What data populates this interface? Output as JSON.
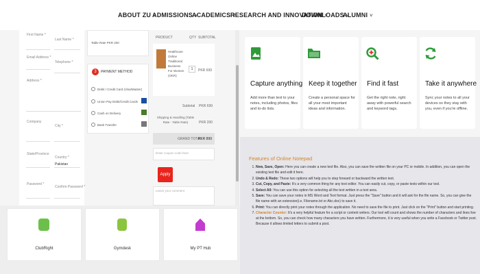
{
  "nav": {
    "items": [
      {
        "label": "ABOUT ZU"
      },
      {
        "label": "ADMISSIONS"
      },
      {
        "label": "ACADEMICS"
      },
      {
        "label": "RESEARCH AND INNOVATION"
      },
      {
        "label": "DOWNLOADS"
      },
      {
        "label": "ALUMNI"
      }
    ]
  },
  "checkout": {
    "first_name": "First Name *",
    "last_name": "Last Name *",
    "email": "Email Address *",
    "telephone": "Telephone *",
    "address": "Address *",
    "company": "Company",
    "city": "City *",
    "state": "State/Province",
    "country": "Country *",
    "country_value": "Pakistan",
    "password": "Password *",
    "confirm_password": "Confirm Password *",
    "table_rate": "Table Rate PKR 200",
    "payment_step": "3",
    "payment_title": "PAYMENT METHOD",
    "payment_options": [
      {
        "label": "Debit / Credit Card (Visa/Master)"
      },
      {
        "label": "Union Pay Debit/Credit Cards"
      },
      {
        "label": "Cash on Delivery"
      },
      {
        "label": "Bank Transfer"
      }
    ],
    "cart_headers": {
      "product": "PRODUCT",
      "qty": "QTY",
      "subtotal": "SUBTOTAL"
    },
    "product_name": "Healthcare Online Traditional Business For Women (OKR)",
    "product_qty": "1",
    "product_price": "PKR 699",
    "subtotal_label": "Subtotal",
    "subtotal_value": "PKR 699",
    "shipping_label": "Shipping & Handling (Table Rate - Table Rate)",
    "shipping_value": "PKR 200",
    "grand_total_label": "GRAND TOTAL",
    "grand_total_value": "PKR 899",
    "coupon_placeholder": "Enter coupon code here",
    "apply_label": "Apply",
    "comment_placeholder": "Leave your comment"
  },
  "logos": [
    {
      "name": "ClubRight",
      "color": "#6cc04a"
    },
    {
      "name": "Gymdesk",
      "color": "#8bc53f"
    },
    {
      "name": "My PT Hub",
      "color": "#c43ccf"
    }
  ],
  "features": [
    {
      "icon": "bookmark-picture-icon",
      "title": "Capture anything",
      "desc": "Add more than text to your notes, including photos, files and to-do lists.",
      "color": "#2e9b3a"
    },
    {
      "icon": "folder-icon",
      "title": "Keep it together",
      "desc": "Create a personal space for all your most important ideas and information.",
      "color": "#2e9b3a"
    },
    {
      "icon": "search-plus-icon",
      "title": "Find it fast",
      "desc": "Get the right note, right away with powerful search and keyword tags.",
      "color": "#2e9b3a"
    },
    {
      "icon": "sync-icon",
      "title": "Take it anywhere",
      "desc": "Sync your notes to all your devices so they stay with you, even if you're offline.",
      "color": "#2e9b3a"
    }
  ],
  "notes": {
    "title": "Features of Online Notepad",
    "items": [
      {
        "head": "New, Save, Open:",
        "text": " Here you can create a new text file. Also, you can save the written file on your PC or mobile. In addition, you can open the existing text file and edit it here."
      },
      {
        "head": "Undo & Redo:",
        "text": " These two options will help you to step forward or backward the written text."
      },
      {
        "head": "Cut, Copy, and Paste:",
        "text": " It's a very common thing for any text editor. You can easily cut, copy, or paste texts within our tool."
      },
      {
        "head": "Select All:",
        "text": " You can use this option for selecting all the text written in a text area."
      },
      {
        "head": "Save:",
        "text": " You can save your notes in MS Word and Text format. Just press the \"Save\" button and it will ask for the file name. So, you can give the file name with an extension(i.e. Filename.txt or Abc.doc) to save it."
      },
      {
        "head": "Print:",
        "text": " You can directly print your notes through the application. No need to save the file to print. Just click on the \"Print\" button and start printing."
      },
      {
        "head": "Character Counter:",
        "text": " It's a very helpful feature for a script or content writers. Our tool will count and shows the number of characters and lines live at the bottom. So, you can check how many characters you have written. Furthermore, it is very useful when you write a Facebook or Twitter post. Because it allows limited letters to submit a post."
      }
    ]
  }
}
